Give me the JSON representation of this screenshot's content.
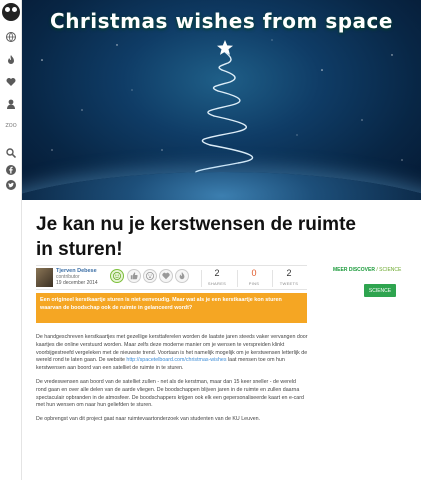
{
  "rail": {
    "zoo_label": "ZOO",
    "icons": [
      "globe-icon",
      "flame-icon",
      "heart-icon",
      "user-icon",
      "search-icon",
      "facebook-icon",
      "twitter-icon"
    ]
  },
  "hero": {
    "title": "Christmas wishes from space"
  },
  "article": {
    "title": "Je kan nu je kerstwensen de ruimte in sturen!",
    "author": {
      "name": "Tjerven Debese",
      "role": "contributor",
      "date": "19 december 2014"
    },
    "stats": [
      {
        "value": "2",
        "label": "SHARES"
      },
      {
        "value": "0",
        "label": "PINS"
      },
      {
        "value": "2",
        "label": "TWEETS"
      }
    ],
    "lead": "Een origineel kerstkaartje sturen is niet eenvoudig. Maar wat als je een kerstkaartje kon sturen waarvan de boodschap ook de ruimte in gelanceerd wordt?",
    "paragraphs": [
      {
        "pre": "De handgeschreven kerstkaartjes met gezellige kersttaferelen worden de laatste jaren steeds vaker vervangen door kaartjes die online verstuurd worden. Maar zelfs deze moderne manier om je wensen te verspreiden klinkt voorbijgestreefd vergeleken met de nieuwste trend. Voortaan is het namelijk mogelijk om je kerstwensen letterlijk de wereld rond te laten gaan. De website ",
        "link": "http://spacetelboard.com/christmas-wishes",
        "post": " laat mensen toe om hun kerstwensen aan boord van een satelliet de ruimte in te sturen."
      },
      {
        "pre": "De vredeswensen aan boord van de satelliet zullen - net als de kerstman, maar dan 15 keer sneller - de wereld rond gaan en over alle delen van de aarde vliegen. De boodschappen blijven jaren in de ruimte en zullen daarna spectaculair opbranden in de atmosfeer. De boodschappers krijgen ook elk een gepersonaliseerde kaart en e-card met hun wensen om naar hun geliefden te sturen.",
        "link": "",
        "post": ""
      },
      {
        "pre": "De opbrengst van dit project gaat naar ruimtevaartonderzoek van studenten van de KU Leuven.",
        "link": "",
        "post": ""
      }
    ]
  },
  "sidebar": {
    "crumb_a": "MEER DISCOVER",
    "crumb_sep": " / ",
    "crumb_b": "SCIENCE",
    "category_button": "SCIENCE"
  },
  "colors": {
    "lead_bg": "#f5a623",
    "accent_green": "#2ea44f",
    "link_blue": "#3b8bd6",
    "hero_bg": "#0f3c66"
  }
}
